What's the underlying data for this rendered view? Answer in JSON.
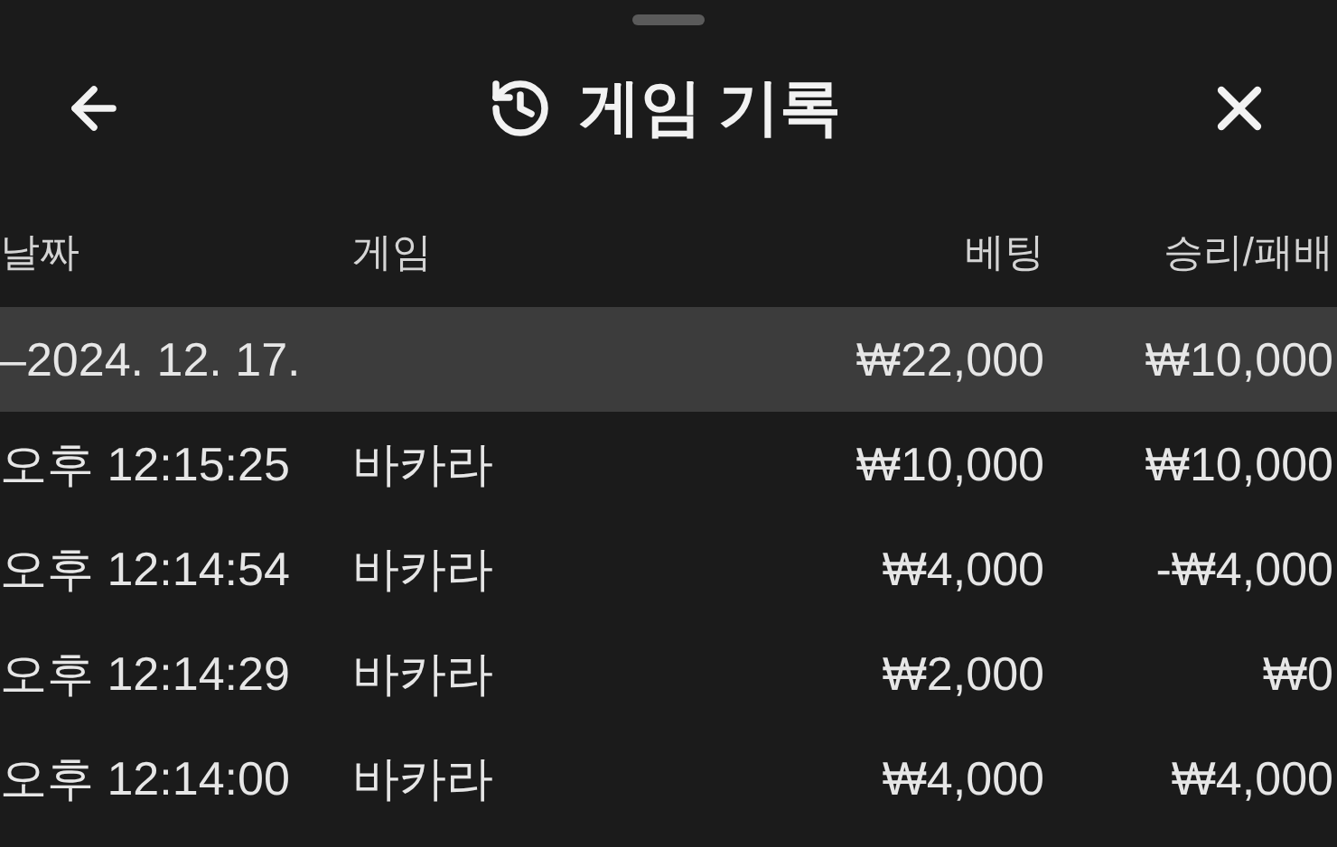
{
  "header": {
    "title": "게임 기록"
  },
  "table": {
    "columns": [
      "날짜",
      "게임",
      "베팅",
      "승리/패배"
    ],
    "group": {
      "date": "–2024. 12. 17.",
      "bet": "₩22,000",
      "result": "₩10,000"
    },
    "rows": [
      {
        "time": "오후 12:15:25",
        "game": "바카라",
        "bet": "₩10,000",
        "result": "₩10,000"
      },
      {
        "time": "오후 12:14:54",
        "game": "바카라",
        "bet": "₩4,000",
        "result": "-₩4,000"
      },
      {
        "time": "오후 12:14:29",
        "game": "바카라",
        "bet": "₩2,000",
        "result": "₩0"
      },
      {
        "time": "오후 12:14:00",
        "game": "바카라",
        "bet": "₩4,000",
        "result": "₩4,000"
      }
    ]
  }
}
